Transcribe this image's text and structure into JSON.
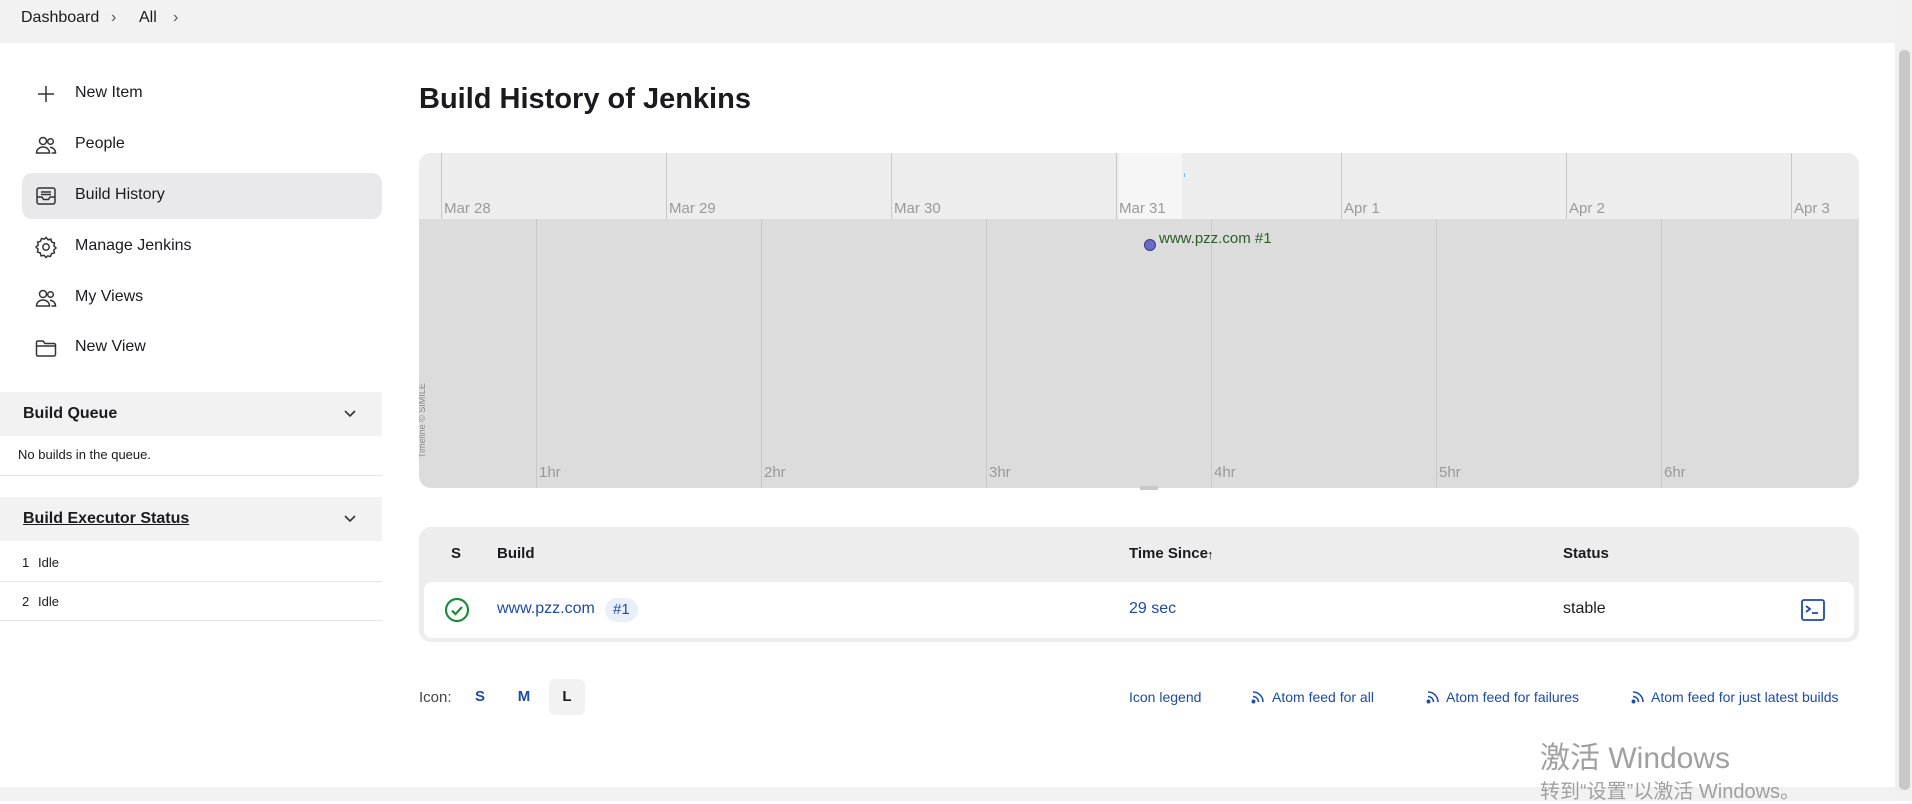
{
  "breadcrumb": {
    "items": [
      "Dashboard",
      "All"
    ]
  },
  "sidebar": {
    "items": [
      {
        "label": "New Item",
        "icon": "plus-icon"
      },
      {
        "label": "People",
        "icon": "people-icon"
      },
      {
        "label": "Build History",
        "icon": "inbox-icon",
        "active": true
      },
      {
        "label": "Manage Jenkins",
        "icon": "gear-icon"
      },
      {
        "label": "My Views",
        "icon": "people-icon"
      },
      {
        "label": "New View",
        "icon": "folder-icon"
      }
    ]
  },
  "build_queue": {
    "title": "Build Queue",
    "empty_text": "No builds in the queue."
  },
  "executor_status": {
    "title": "Build Executor Status",
    "executors": [
      {
        "num": "1",
        "state": "Idle"
      },
      {
        "num": "2",
        "state": "Idle"
      }
    ]
  },
  "main": {
    "title": "Build History of Jenkins",
    "timeline": {
      "dates": [
        "Mar 28",
        "Mar 29",
        "Mar 30",
        "Mar 31",
        "Apr 1",
        "Apr 2",
        "Apr 3"
      ],
      "hours": [
        "1hr",
        "2hr",
        "3hr",
        "4hr",
        "5hr",
        "6hr"
      ],
      "event_label": "www.pzz.com #1",
      "credit": "Timeline © SIMILE"
    },
    "table": {
      "headers": {
        "s": "S",
        "build": "Build",
        "time_since": "Time Since",
        "sort_indicator": "↑",
        "status": "Status"
      },
      "rows": [
        {
          "project": "www.pzz.com",
          "build_num": "#1",
          "time_since": "29 sec",
          "status": "stable"
        }
      ]
    },
    "icon_size": {
      "label": "Icon:",
      "options": [
        "S",
        "M",
        "L"
      ],
      "selected": "L"
    },
    "links": {
      "legend": "Icon legend",
      "feed_all": "Atom feed for all",
      "feed_failures": "Atom feed for failures",
      "feed_latest": "Atom feed for just latest builds"
    }
  },
  "watermark": {
    "line1": "激活 Windows",
    "line2": "转到“设置”以激活 Windows。"
  },
  "colors": {
    "link": "#1c4ba8",
    "success": "#1e8c3a"
  }
}
